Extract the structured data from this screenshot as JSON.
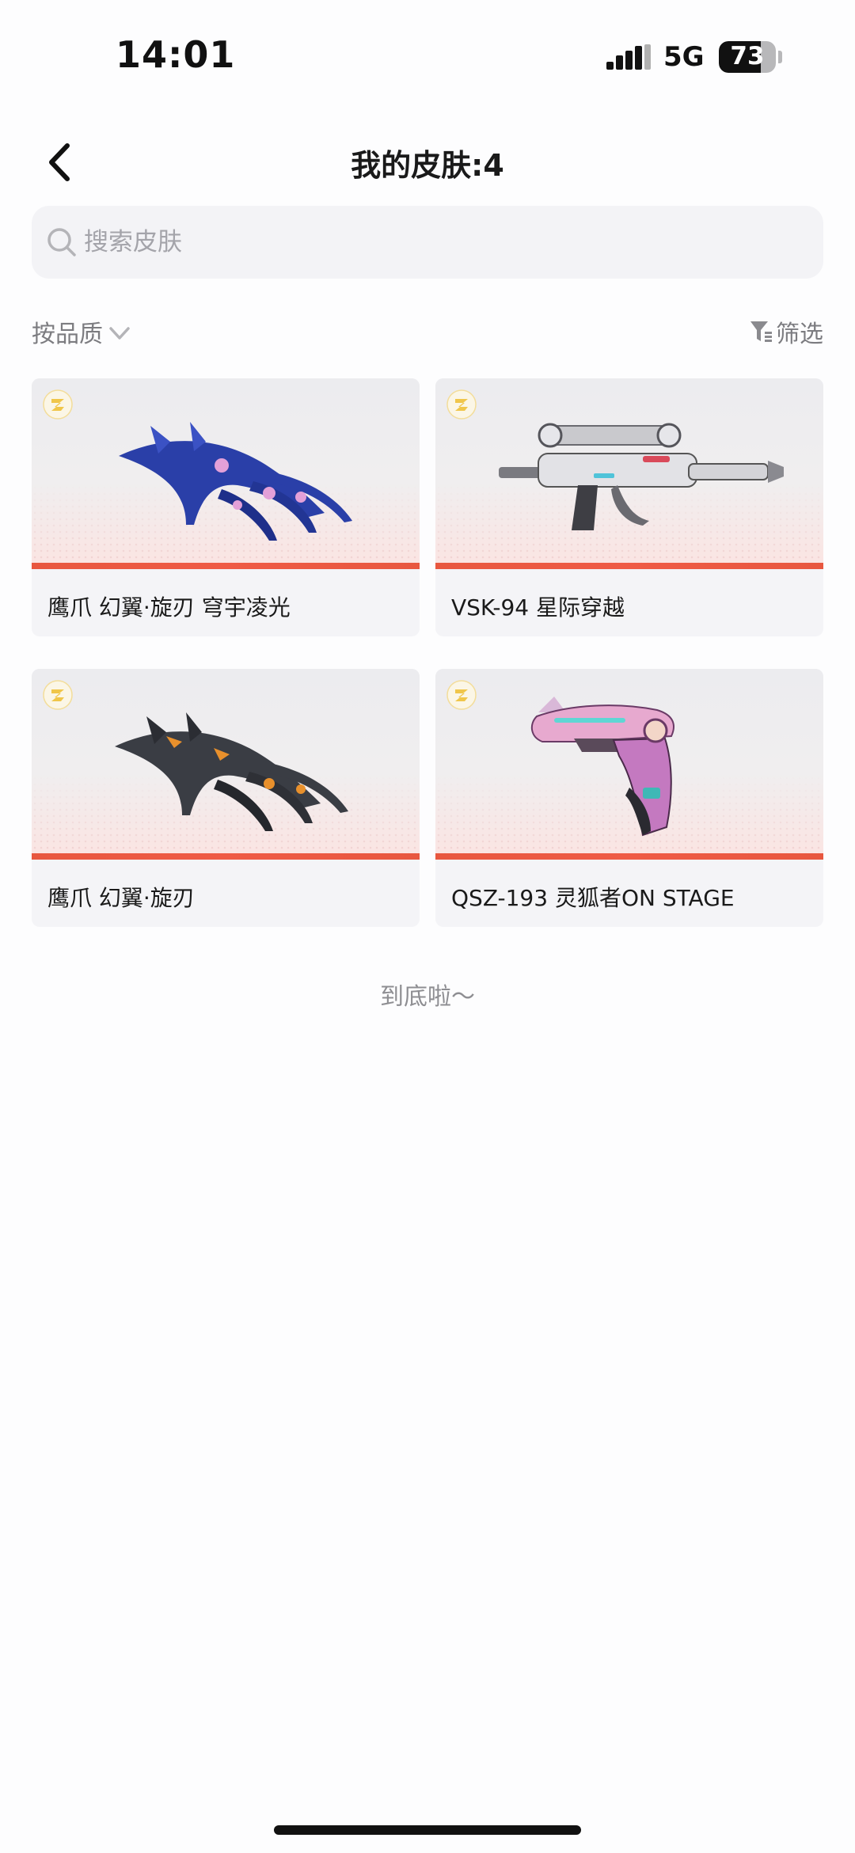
{
  "status_bar": {
    "time": "14:01",
    "network": "5G",
    "battery": "73",
    "battery_level": 0.73
  },
  "nav": {
    "title": "我的皮肤:4"
  },
  "search": {
    "placeholder": "搜索皮肤",
    "value": ""
  },
  "toolbar": {
    "sort_label": "按品质",
    "filter_label": "筛选"
  },
  "skins": [
    {
      "name": "鹰爪 幻翼·旋刃 穹宇凌光",
      "art": "claw-blue-icon"
    },
    {
      "name": "VSK-94 星际穿越",
      "art": "rifle-white-icon"
    },
    {
      "name": "鹰爪 幻翼·旋刃",
      "art": "claw-dark-icon"
    },
    {
      "name": "QSZ-193 灵狐者ON STAGE",
      "art": "pistol-pink-icon"
    }
  ],
  "footer": {
    "end_text": "到底啦～"
  },
  "colors": {
    "accent_stripe": "#ef5b45",
    "card_bg": "#f4f4f7",
    "search_bg": "#f3f3f6",
    "muted_text": "#7c7c80"
  }
}
